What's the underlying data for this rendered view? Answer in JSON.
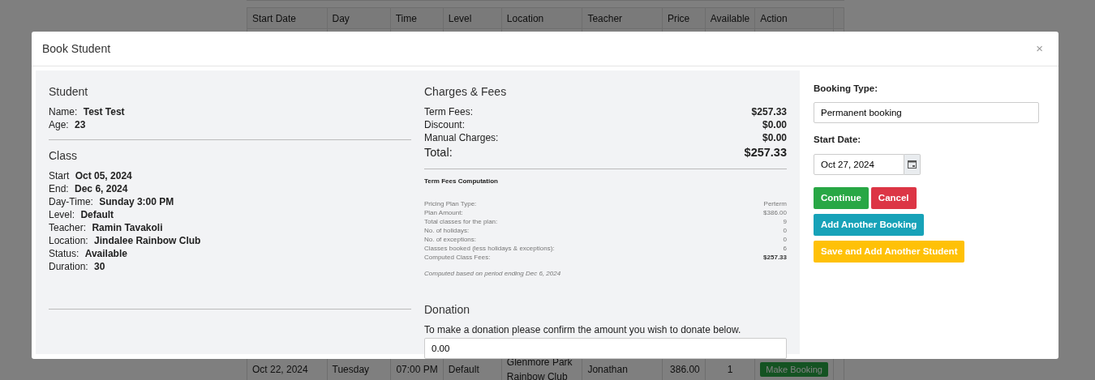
{
  "background_table": {
    "columns": [
      "Start Date",
      "Day",
      "Time",
      "Level",
      "Location",
      "Teacher",
      "Price",
      "Available",
      "Action"
    ],
    "rows": [
      {
        "cells": [
          "Oct 22, 2024",
          "Tuesday",
          "07:00 PM",
          "Default",
          "Glenmore Park Rainbow Club",
          "Jonathan",
          "386.00",
          "1"
        ],
        "action": "Make Booking"
      }
    ]
  },
  "modal": {
    "title": "Book Student",
    "close": "×",
    "student": {
      "heading": "Student",
      "fields": [
        {
          "label": "Name:",
          "value": "Test Test"
        },
        {
          "label": "Age:",
          "value": "23"
        }
      ]
    },
    "class": {
      "heading": "Class",
      "fields": [
        {
          "label": "Start",
          "value": "Oct 05, 2024"
        },
        {
          "label": "End:",
          "value": "Dec 6, 2024"
        },
        {
          "label": "Day-Time:",
          "value": "Sunday 3:00 PM"
        },
        {
          "label": "Level:",
          "value": "Default"
        },
        {
          "label": "Teacher:",
          "value": "Ramin Tavakoli"
        },
        {
          "label": "Location:",
          "value": "Jindalee Rainbow Club"
        },
        {
          "label": "Status:",
          "value": "Available"
        },
        {
          "label": "Duration:",
          "value": "30"
        }
      ]
    },
    "charges": {
      "heading": "Charges & Fees",
      "lines": [
        {
          "label": "Term Fees:",
          "value": "$257.33"
        },
        {
          "label": "Discount:",
          "value": "$0.00"
        },
        {
          "label": "Manual Charges:",
          "value": "$0.00"
        }
      ],
      "total": {
        "label": "Total:",
        "value": "$257.33"
      }
    },
    "computation": {
      "heading": "Term Fees Computation",
      "lines": [
        {
          "label": "Pricing Plan Type:",
          "value": "Perterm",
          "bold": false
        },
        {
          "label": "Plan Amount:",
          "value": "$386.00",
          "bold": false
        },
        {
          "label": "Total classes for the plan:",
          "value": "9",
          "bold": false
        },
        {
          "label": "No. of holidays:",
          "value": "0",
          "bold": false
        },
        {
          "label": "No. of exceptions:",
          "value": "0",
          "bold": false
        },
        {
          "label": "Classes booked (less holidays & exceptions):",
          "value": "6",
          "bold": false
        },
        {
          "label": "Computed Class Fees:",
          "value": "$257.33",
          "bold": true
        }
      ],
      "note": "Computed based on period ending Dec 6, 2024"
    },
    "donation": {
      "heading": "Donation",
      "prompt": "To make a donation please confirm the amount you wish to donate below.",
      "value": "0.00"
    },
    "booking_type": {
      "label": "Booking Type:",
      "value": "Permanent booking"
    },
    "start_date": {
      "label": "Start Date:",
      "value": "Oct 27, 2024"
    },
    "buttons": [
      {
        "label": "Continue",
        "kind": "success"
      },
      {
        "label": "Cancel",
        "kind": "danger"
      },
      {
        "label": "Add Another Booking",
        "kind": "info"
      },
      {
        "label": "Save and Add Another Student",
        "kind": "warning"
      }
    ]
  }
}
